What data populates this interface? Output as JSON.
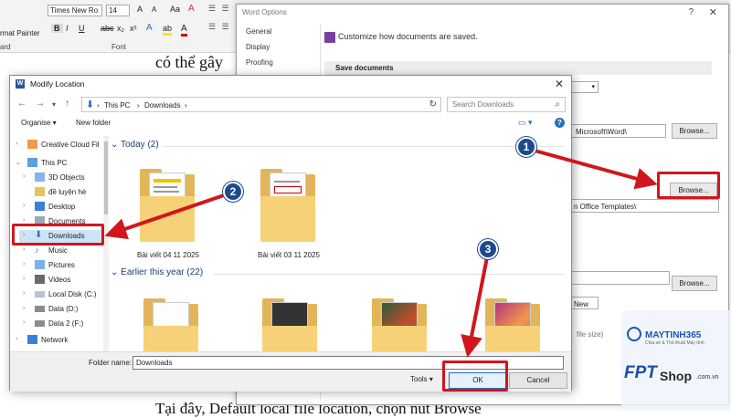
{
  "ribbon": {
    "font_name": "Times New Ro",
    "font_size": "14",
    "grow_font": "A",
    "shrink_font": "A",
    "case_button": "Aa",
    "clear_format": "A",
    "bold": "B",
    "italic": "I",
    "underline": "U",
    "strike": "abc",
    "subscript": "x₂",
    "superscript": "x²",
    "text_effects": "A",
    "highlight": "ab",
    "font_color": "A",
    "copy": "",
    "format_painter": "rmat Painter",
    "clipboard_group": "ard",
    "font_group": "Font"
  },
  "doc": {
    "top_fragment": "có thể gây",
    "bottom_fragment": "Tại đây, Default local file location, chọn nút Browse",
    "right_char_1": "a",
    "right_char_2": "r"
  },
  "word_options": {
    "title": "Word Options",
    "help": "?",
    "close": "✕",
    "nav": [
      "General",
      "Display",
      "Proofing"
    ],
    "banner": "Customize how documents are saved.",
    "section": "Save documents",
    "path_1": "Microsoft\\Word\\",
    "browse_1": "Browse...",
    "browse_2": "Browse...",
    "path_2": "n Office Templates\\",
    "browse_3": "Browse...",
    "new_select": "New",
    "file_size_hint": "file size)",
    "number_1": "1"
  },
  "modify_location": {
    "title": "Modify Location",
    "close": "✕",
    "breadcrumb": [
      "This PC",
      "Downloads"
    ],
    "search_placeholder": "Search Downloads",
    "organise": "Organise ▾",
    "new_folder": "New folder",
    "help": "?",
    "sidebar": [
      {
        "label": "Creative Cloud Fil",
        "icon": "creative-cloud"
      },
      {
        "label": "This PC",
        "icon": "computer"
      },
      {
        "label": "3D Objects",
        "icon": "3d-objects"
      },
      {
        "label": "đề luyện hè",
        "icon": "folder"
      },
      {
        "label": "Desktop",
        "icon": "desktop"
      },
      {
        "label": "Documents",
        "icon": "documents"
      },
      {
        "label": "Downloads",
        "icon": "downloads"
      },
      {
        "label": "Music",
        "icon": "music"
      },
      {
        "label": "Pictures",
        "icon": "pictures"
      },
      {
        "label": "Videos",
        "icon": "videos"
      },
      {
        "label": "Local Disk (C:)",
        "icon": "disk"
      },
      {
        "label": "Data (D:)",
        "icon": "disk"
      },
      {
        "label": "Data 2 (F:)",
        "icon": "disk"
      },
      {
        "label": "Network",
        "icon": "network"
      }
    ],
    "group_today": "Today (2)",
    "group_earlier": "Earlier this year (22)",
    "folders_today": [
      "Bài viết 04 11 2025",
      "Bài viết 03 11 2025"
    ],
    "folder_name_label": "Folder name:",
    "folder_name_value": "Downloads",
    "tools": "Tools ▾",
    "ok": "OK",
    "cancel": "Cancel",
    "number_2": "2",
    "number_3": "3"
  },
  "watermark": {
    "brand": "MAYTINH365",
    "brand_sub": "Chia sẻ & Thủ thuật Máy tính",
    "fpt": "FPT",
    "shop": "Shop",
    "domain": ".com.vn"
  },
  "colors": {
    "highlight_red": "#d1161d",
    "badge_blue": "#1d4a8c",
    "folder_yellow": "#f7d178"
  }
}
